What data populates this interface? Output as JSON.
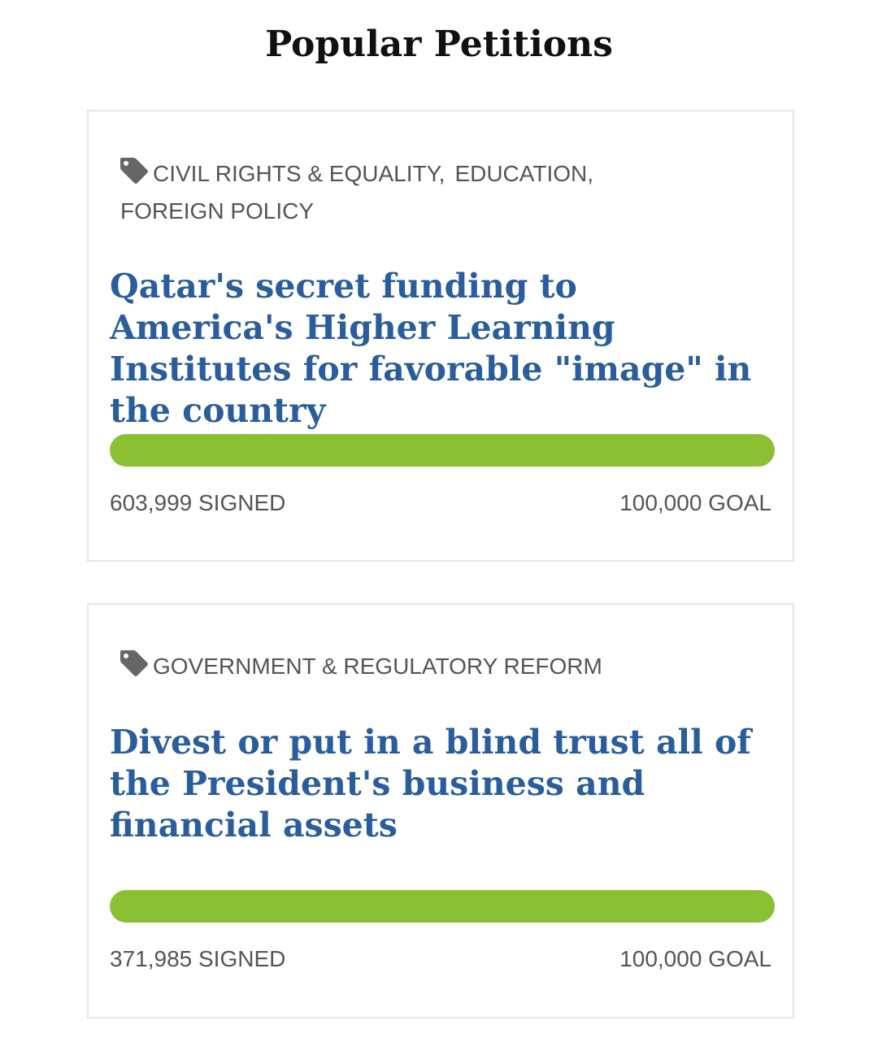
{
  "page": {
    "title": "Popular Petitions"
  },
  "colors": {
    "title_link": "#2a5d9c",
    "progress_fill": "#8cc033",
    "tag_text": "#555555",
    "card_border": "#e6e6e6"
  },
  "petitions": [
    {
      "tag_icon": "tag-icon",
      "tags": [
        "CIVIL RIGHTS & EQUALITY",
        "EDUCATION",
        "FOREIGN POLICY"
      ],
      "title": "Qatar's secret funding to America's Higher Learning Institutes for favorable \"image\" in the country",
      "progress_fraction": 1.0,
      "signed": "603,999 SIGNED",
      "goal": "100,000 GOAL"
    },
    {
      "tag_icon": "tag-icon",
      "tags": [
        "GOVERNMENT & REGULATORY REFORM"
      ],
      "title": "Divest or put in a blind trust all of the President's business and financial assets",
      "progress_fraction": 1.0,
      "signed": "371,985 SIGNED",
      "goal": "100,000 GOAL"
    }
  ]
}
